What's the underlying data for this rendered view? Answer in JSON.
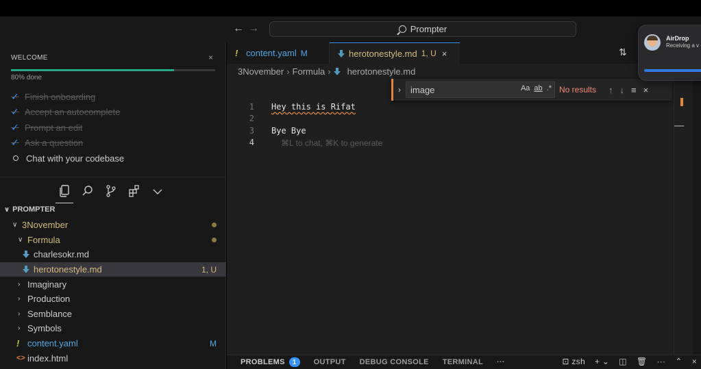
{
  "titlebar": {
    "search_text": "Prompter"
  },
  "welcome": {
    "title": "WELCOME",
    "progress_text": "80% done",
    "progress_fraction": 0.8,
    "steps": [
      {
        "label": "Finish onboarding",
        "done": true
      },
      {
        "label": "Accept an autocomplete",
        "done": true
      },
      {
        "label": "Prompt an edit",
        "done": true
      },
      {
        "label": "Ask a question",
        "done": true
      },
      {
        "label": "Chat with your codebase",
        "done": false
      }
    ]
  },
  "explorer": {
    "title": "PROMPTER",
    "items": [
      {
        "label": "3November"
      },
      {
        "label": "Formula"
      },
      {
        "label": "charlesokr.md"
      },
      {
        "label": "herotonestyle.md",
        "badge": "1, U"
      },
      {
        "label": "Imaginary"
      },
      {
        "label": "Production"
      },
      {
        "label": "Semblance"
      },
      {
        "label": "Symbols"
      },
      {
        "label": "content.yaml",
        "badge": "M"
      },
      {
        "label": "index.html"
      }
    ]
  },
  "tabs": [
    {
      "label": "content.yaml",
      "tag": "M"
    },
    {
      "label": "herotonestyle.md",
      "tag": "1, U",
      "close": "×"
    }
  ],
  "breadcrumb": [
    "3November",
    "Formula",
    "herotonestyle.md"
  ],
  "find": {
    "query": "image",
    "case_label": "Aa",
    "word_label": "ab",
    "regex_label": ".*",
    "result_text": "No results"
  },
  "editor": {
    "lines": [
      {
        "num": "1",
        "text": "Hey this is Rifat"
      },
      {
        "num": "2",
        "text": ""
      },
      {
        "num": "3",
        "text": "Bye Bye"
      },
      {
        "num": "4",
        "text": ""
      }
    ],
    "hint": "⌘L to chat, ⌘K to generate"
  },
  "panel": {
    "tabs": [
      {
        "label": "PROBLEMS",
        "badge": "1"
      },
      {
        "label": "OUTPUT"
      },
      {
        "label": "DEBUG CONSOLE"
      },
      {
        "label": "TERMINAL"
      },
      {
        "label": "···"
      }
    ],
    "terminal_name": "zsh"
  },
  "notification": {
    "title": "AirDrop",
    "subtitle": "Receiving a v"
  },
  "colors": {
    "accent": "#3794ff",
    "modified": "#d7ba7d",
    "progress": "#2aa889",
    "find_error": "#f48771"
  }
}
